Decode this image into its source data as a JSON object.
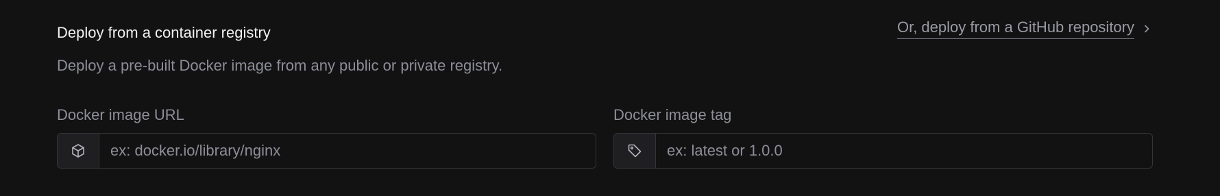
{
  "header": {
    "title": "Deploy from a container registry",
    "github_link_label": "Or, deploy from a GitHub repository",
    "subtitle": "Deploy a pre-built Docker image from any public or private registry."
  },
  "fields": {
    "image_url": {
      "label": "Docker image URL",
      "icon": "package-icon",
      "value": "",
      "placeholder": "ex: docker.io/library/nginx"
    },
    "image_tag": {
      "label": "Docker image tag",
      "icon": "tag-icon",
      "value": "",
      "placeholder": "ex: latest or 1.0.0"
    }
  },
  "colors": {
    "background": "#121212",
    "text_primary": "#f2f2f4",
    "text_muted": "#8e8e9a",
    "border": "#34343a",
    "addon_bg": "#1f1f22"
  }
}
